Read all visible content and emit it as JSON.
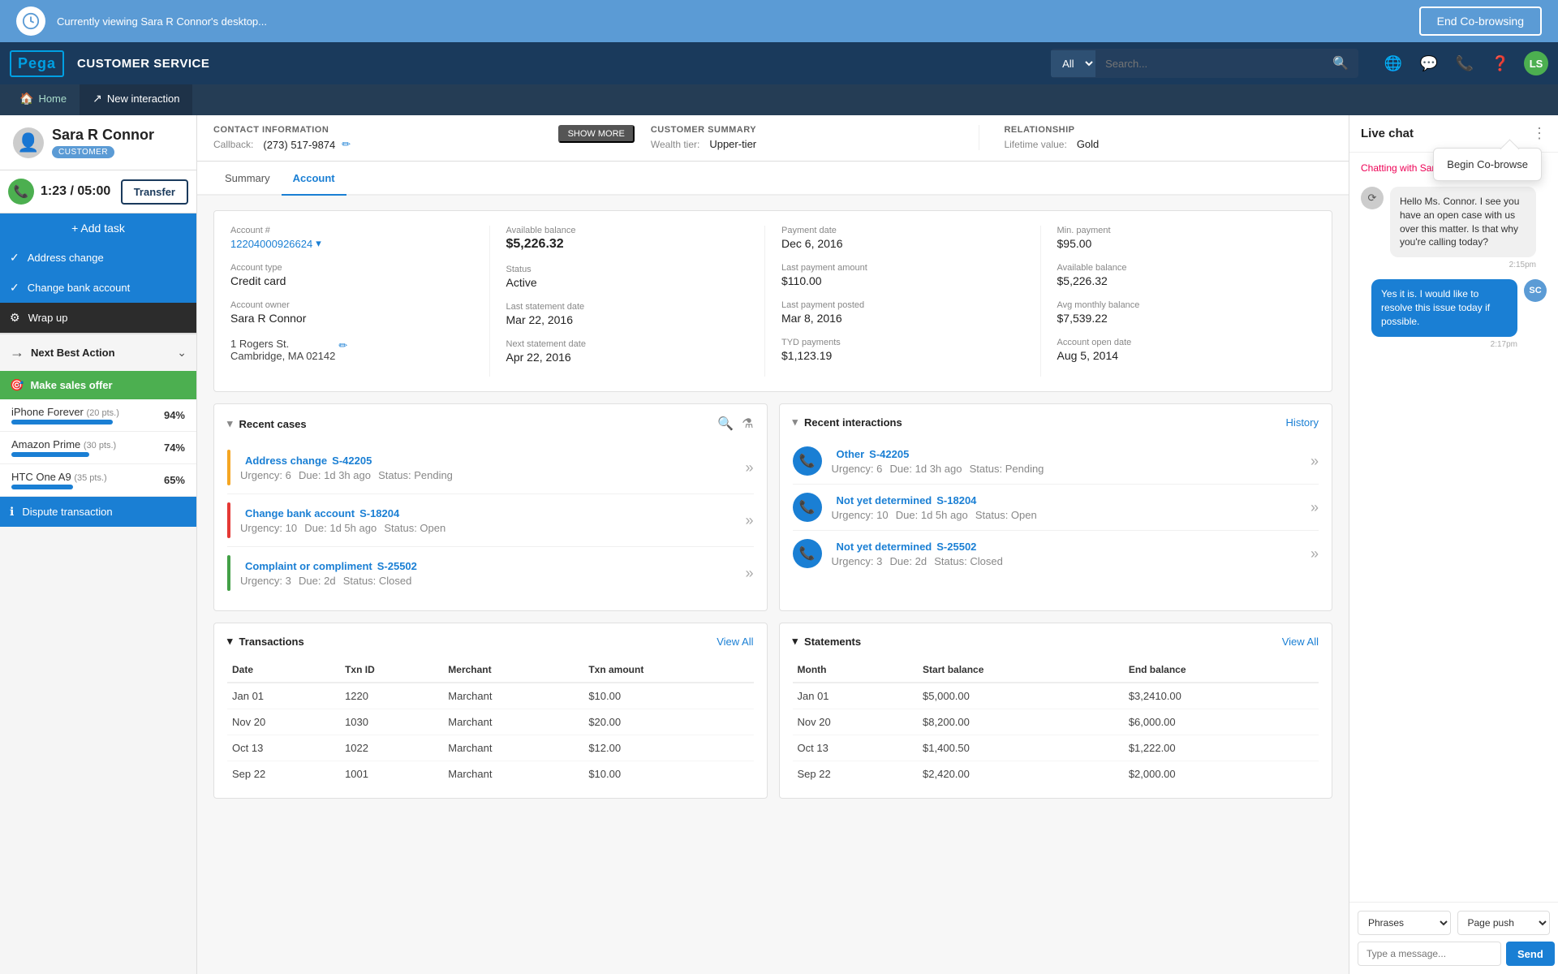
{
  "cobrowse": {
    "banner_text": "Currently viewing Sara R Connor's desktop...",
    "end_button": "End Co-browsing"
  },
  "topnav": {
    "logo": "Pega",
    "service_label": "CUSTOMER SERVICE",
    "search_placeholder": "",
    "search_option": "All",
    "user_initials": "LS"
  },
  "tabs": [
    {
      "label": "Home",
      "icon": "🏠",
      "active": false
    },
    {
      "label": "New interaction",
      "icon": "↗",
      "active": false
    }
  ],
  "customer": {
    "name": "Sara R Connor",
    "badge": "CUSTOMER"
  },
  "call": {
    "timer": "1:23 / 05:00",
    "transfer_btn": "Transfer"
  },
  "sidebar": {
    "add_task": "+ Add task",
    "tasks": [
      {
        "label": "Address change",
        "icon": "✓",
        "style": "active"
      },
      {
        "label": "Change bank account",
        "icon": "✓",
        "style": "active"
      },
      {
        "label": "Wrap up",
        "icon": "⚙",
        "style": "dark"
      }
    ],
    "nba_title": "Next Best Action",
    "nba_action": "Make sales offer",
    "nba_action_icon": "🎯",
    "offers": [
      {
        "name": "iPhone Forever",
        "pts": "(20 pts.)",
        "pct": "94%",
        "bar_pct": 94
      },
      {
        "name": "Amazon Prime",
        "pts": "(30 pts.)",
        "pct": "74%",
        "bar_pct": 74
      },
      {
        "name": "HTC One A9",
        "pts": "(35 pts.)",
        "pct": "65%",
        "bar_pct": 65
      }
    ],
    "dispute": "Dispute transaction",
    "dispute_icon": "ℹ"
  },
  "contact_info": {
    "section_title": "CONTACT INFORMATION",
    "callback_label": "Callback:",
    "callback_value": "(273) 517-9874",
    "show_more": "SHOW MORE"
  },
  "customer_summary": {
    "section_title": "CUSTOMER SUMMARY",
    "wealth_tier_label": "Wealth tier:",
    "wealth_tier_value": "Upper-tier"
  },
  "relationship": {
    "section_title": "RELATIONSHIP",
    "lifetime_label": "Lifetime value:",
    "lifetime_value": "Gold"
  },
  "content_tabs": [
    {
      "label": "Summary",
      "active": false
    },
    {
      "label": "Account",
      "active": true
    }
  ],
  "account": {
    "number_label": "Account #",
    "number_value": "12204000926624",
    "type_label": "Account type",
    "type_value": "Credit card",
    "owner_label": "Account owner",
    "owner_value": "Sara R Connor",
    "address": "1 Rogers St.\nCambridge, MA 02142",
    "avail_balance_label": "Available balance",
    "avail_balance_value": "$5,226.32",
    "status_label": "Status",
    "status_value": "Active",
    "last_statement_label": "Last statement date",
    "last_statement_value": "Mar 22, 2016",
    "next_statement_label": "Next statement date",
    "next_statement_value": "Apr 22, 2016",
    "payment_date_label": "Payment date",
    "payment_date_value": "Dec 6, 2016",
    "last_payment_label": "Last payment amount",
    "last_payment_value": "$110.00",
    "last_payment_posted_label": "Last payment posted",
    "last_payment_posted_value": "Mar 8, 2016",
    "tyd_label": "TYD payments",
    "tyd_value": "$1,123.19",
    "min_payment_label": "Min. payment",
    "min_payment_value": "$95.00",
    "avail_bal2_label": "Available balance",
    "avail_bal2_value": "$5,226.32",
    "avg_monthly_label": "Avg monthly balance",
    "avg_monthly_value": "$7,539.22",
    "open_date_label": "Account open date",
    "open_date_value": "Aug 5, 2014"
  },
  "recent_cases": {
    "title": "Recent cases",
    "cases": [
      {
        "name": "Address change",
        "id": "S-42205",
        "urgency": "Urgency: 6",
        "due": "Due: 1d 3h ago",
        "status": "Status: Pending",
        "bar_color": "yellow"
      },
      {
        "name": "Change bank account",
        "id": "S-18204",
        "urgency": "Urgency: 10",
        "due": "Due: 1d 5h ago",
        "status": "Status: Open",
        "bar_color": "red"
      },
      {
        "name": "Complaint or compliment",
        "id": "S-25502",
        "urgency": "Urgency: 3",
        "due": "Due: 2d",
        "status": "Status: Closed",
        "bar_color": "green"
      }
    ]
  },
  "recent_interactions": {
    "title": "Recent interactions",
    "history_label": "History",
    "interactions": [
      {
        "type": "Other",
        "id": "S-42205",
        "urgency": "Urgency: 6",
        "due": "Due: 1d 3h ago",
        "status": "Status: Pending"
      },
      {
        "type": "Not yet determined",
        "id": "S-18204",
        "urgency": "Urgency: 10",
        "due": "Due: 1d 5h ago",
        "status": "Status: Open"
      },
      {
        "type": "Not yet determined",
        "id": "S-25502",
        "urgency": "Urgency: 3",
        "due": "Due: 2d",
        "status": "Status: Closed"
      }
    ]
  },
  "transactions": {
    "title": "Transactions",
    "view_all": "View All",
    "headers": [
      "Date",
      "Txn ID",
      "Merchant",
      "Txn amount"
    ],
    "rows": [
      {
        "date": "Jan 01",
        "id": "1220",
        "merchant": "Marchant",
        "amount": "$10.00"
      },
      {
        "date": "Nov 20",
        "id": "1030",
        "merchant": "Marchant",
        "amount": "$20.00"
      },
      {
        "date": "Oct 13",
        "id": "1022",
        "merchant": "Marchant",
        "amount": "$12.00"
      },
      {
        "date": "Sep 22",
        "id": "1001",
        "merchant": "Marchant",
        "amount": "$10.00"
      }
    ]
  },
  "statements": {
    "title": "Statements",
    "view_all": "View All",
    "headers": [
      "Month",
      "Start balance",
      "End balance"
    ],
    "rows": [
      {
        "month": "Jan 01",
        "start": "$5,000.00",
        "end": "$3,2410.00"
      },
      {
        "month": "Nov 20",
        "start": "$8,200.00",
        "end": "$6,000.00"
      },
      {
        "month": "Oct 13",
        "start": "$1,400.50",
        "end": "$1,222.00"
      },
      {
        "month": "Sep 22",
        "start": "$2,420.00",
        "end": "$2,000.00"
      }
    ]
  },
  "live_chat": {
    "title": "Live chat",
    "chatter_label": "Chatting with Sara R C",
    "messages": [
      {
        "type": "agent",
        "text": "Hello Ms. Connor. I see you have an open case with us over this matter. Is that why you're calling today?",
        "time": "2:15pm"
      },
      {
        "type": "user",
        "text": "Yes it is. I would like to resolve this issue today if possible.",
        "time": "2:17pm",
        "initials": "SC"
      }
    ],
    "phrases_label": "Phrases",
    "page_push_label": "Page push",
    "type_placeholder": "Type a message...",
    "send_btn": "Send",
    "cobrowse_popup": "Begin Co-browse"
  }
}
